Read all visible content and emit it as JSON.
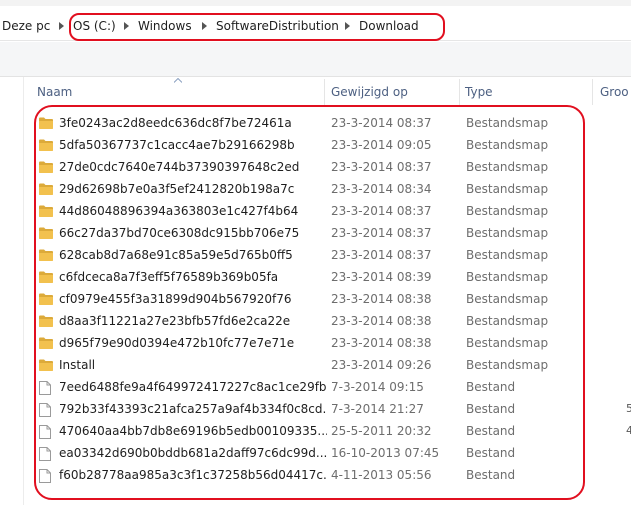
{
  "address_bar": {
    "root": "Deze pc",
    "crumbs": [
      "OS (C:)",
      "Windows",
      "SoftwareDistribution",
      "Download"
    ]
  },
  "columns": {
    "name": "Naam",
    "modified": "Gewijzigd op",
    "type": "Type",
    "size": "Groo"
  },
  "files": [
    {
      "name": "3fe0243ac2d8eedc636dc8f7be72461a",
      "modified": "23-3-2014 08:37",
      "type": "Bestandsmap",
      "kind": "folder"
    },
    {
      "name": "5dfa50367737c1cacc4ae7b29166298b",
      "modified": "23-3-2014 09:05",
      "type": "Bestandsmap",
      "kind": "folder"
    },
    {
      "name": "27de0cdc7640e744b37390397648c2ed",
      "modified": "23-3-2014 08:37",
      "type": "Bestandsmap",
      "kind": "folder"
    },
    {
      "name": "29d62698b7e0a3f5ef2412820b198a7c",
      "modified": "23-3-2014 08:34",
      "type": "Bestandsmap",
      "kind": "folder"
    },
    {
      "name": "44d86048896394a363803e1c427f4b64",
      "modified": "23-3-2014 08:37",
      "type": "Bestandsmap",
      "kind": "folder"
    },
    {
      "name": "66c27da37bd70ce6308dc915bb706e75",
      "modified": "23-3-2014 08:37",
      "type": "Bestandsmap",
      "kind": "folder"
    },
    {
      "name": "628cab8d7a68e91c85a59e5d765b0ff5",
      "modified": "23-3-2014 08:37",
      "type": "Bestandsmap",
      "kind": "folder"
    },
    {
      "name": "c6fdceca8a7f3eff5f76589b369b05fa",
      "modified": "23-3-2014 08:39",
      "type": "Bestandsmap",
      "kind": "folder"
    },
    {
      "name": "cf0979e455f3a31899d904b567920f76",
      "modified": "23-3-2014 08:38",
      "type": "Bestandsmap",
      "kind": "folder"
    },
    {
      "name": "d8aa3f11221a27e23bfb57fd6e2ca22e",
      "modified": "23-3-2014 08:38",
      "type": "Bestandsmap",
      "kind": "folder"
    },
    {
      "name": "d965f79e90d0394e472b10fc77e7e71e",
      "modified": "23-3-2014 08:38",
      "type": "Bestandsmap",
      "kind": "folder"
    },
    {
      "name": "Install",
      "modified": "23-3-2014 09:26",
      "type": "Bestandsmap",
      "kind": "folder"
    },
    {
      "name": "7eed6488fe9a4f649972417227c8ac1ce29fb...",
      "modified": "7-3-2014 09:15",
      "type": "Bestand",
      "kind": "file"
    },
    {
      "name": "792b33f43393c21afca257a9af4b334f0c8cd...",
      "modified": "7-3-2014 21:27",
      "type": "Bestand",
      "kind": "file"
    },
    {
      "name": "470640aa4bb7db8e69196b5edb00109335...",
      "modified": "25-5-2011 20:32",
      "type": "Bestand",
      "kind": "file"
    },
    {
      "name": "ea03342d690b0bddb681a2daff97c6dc99d...",
      "modified": "16-10-2013 07:45",
      "type": "Bestand",
      "kind": "file"
    },
    {
      "name": "f60b28778aa985a3c3f1c37258b56d04417c...",
      "modified": "4-11-2013 05:56",
      "type": "Bestand",
      "kind": "file"
    }
  ],
  "colors": {
    "annotation_red": "#e10f1f",
    "folder_yellow": "#f2c14e",
    "header_text": "#4d6082"
  }
}
